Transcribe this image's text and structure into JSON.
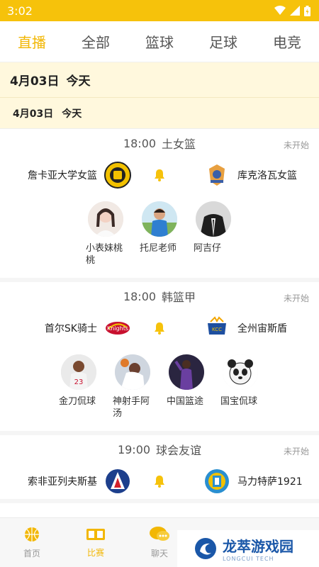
{
  "status_bar": {
    "time": "3:02"
  },
  "top_tabs": [
    {
      "label": "直播",
      "active": true
    },
    {
      "label": "全部",
      "active": false
    },
    {
      "label": "篮球",
      "active": false
    },
    {
      "label": "足球",
      "active": false
    },
    {
      "label": "电竞",
      "active": false
    }
  ],
  "date_header": {
    "date": "4月03日",
    "day": "今天"
  },
  "date_subheader": {
    "date": "4月03日",
    "day": "今天"
  },
  "matches": [
    {
      "time": "18:00",
      "league": "土女篮",
      "status": "未开始",
      "home": {
        "name": "詹卡亚大学女篮",
        "logo_icon": "yellow-badge-logo"
      },
      "away": {
        "name": "库克洛瓦女篮",
        "logo_icon": "orange-tiger-logo"
      },
      "anchors": [
        {
          "name": "小表妹桃桃"
        },
        {
          "name": "托尼老师"
        },
        {
          "name": "阿吉仔"
        }
      ]
    },
    {
      "time": "18:00",
      "league": "韩篮甲",
      "status": "未开始",
      "home": {
        "name": "首尔SK骑士",
        "logo_icon": "knights-logo"
      },
      "away": {
        "name": "全州宙斯盾",
        "logo_icon": "aegis-logo"
      },
      "anchors": [
        {
          "name": "金刀侃球"
        },
        {
          "name": "神射手阿汤"
        },
        {
          "name": "中国篮途"
        },
        {
          "name": "国宝侃球"
        }
      ]
    },
    {
      "time": "19:00",
      "league": "球会友谊",
      "status": "未开始",
      "home": {
        "name": "索非亚列夫斯基",
        "logo_icon": "levski-logo"
      },
      "away": {
        "name": "马力特萨1921",
        "logo_icon": "marsa-logo"
      },
      "anchors": []
    }
  ],
  "bottom_nav": [
    {
      "label": "首页",
      "icon": "basketball-home-icon",
      "active": false
    },
    {
      "label": "比赛",
      "icon": "scoreboard-icon",
      "active": true
    },
    {
      "label": "聊天",
      "icon": "chat-bubble-icon",
      "active": false
    },
    {
      "label": "",
      "icon": "trophy-icon",
      "active": false
    },
    {
      "label": "",
      "icon": "profile-icon",
      "active": false
    }
  ],
  "watermark": {
    "title": "龙萃游戏园",
    "subtitle": "LONGCUI TECH"
  },
  "colors": {
    "accent": "#f2b705",
    "status_bar": "#f6c20b",
    "date_bg": "#fff8dd"
  }
}
